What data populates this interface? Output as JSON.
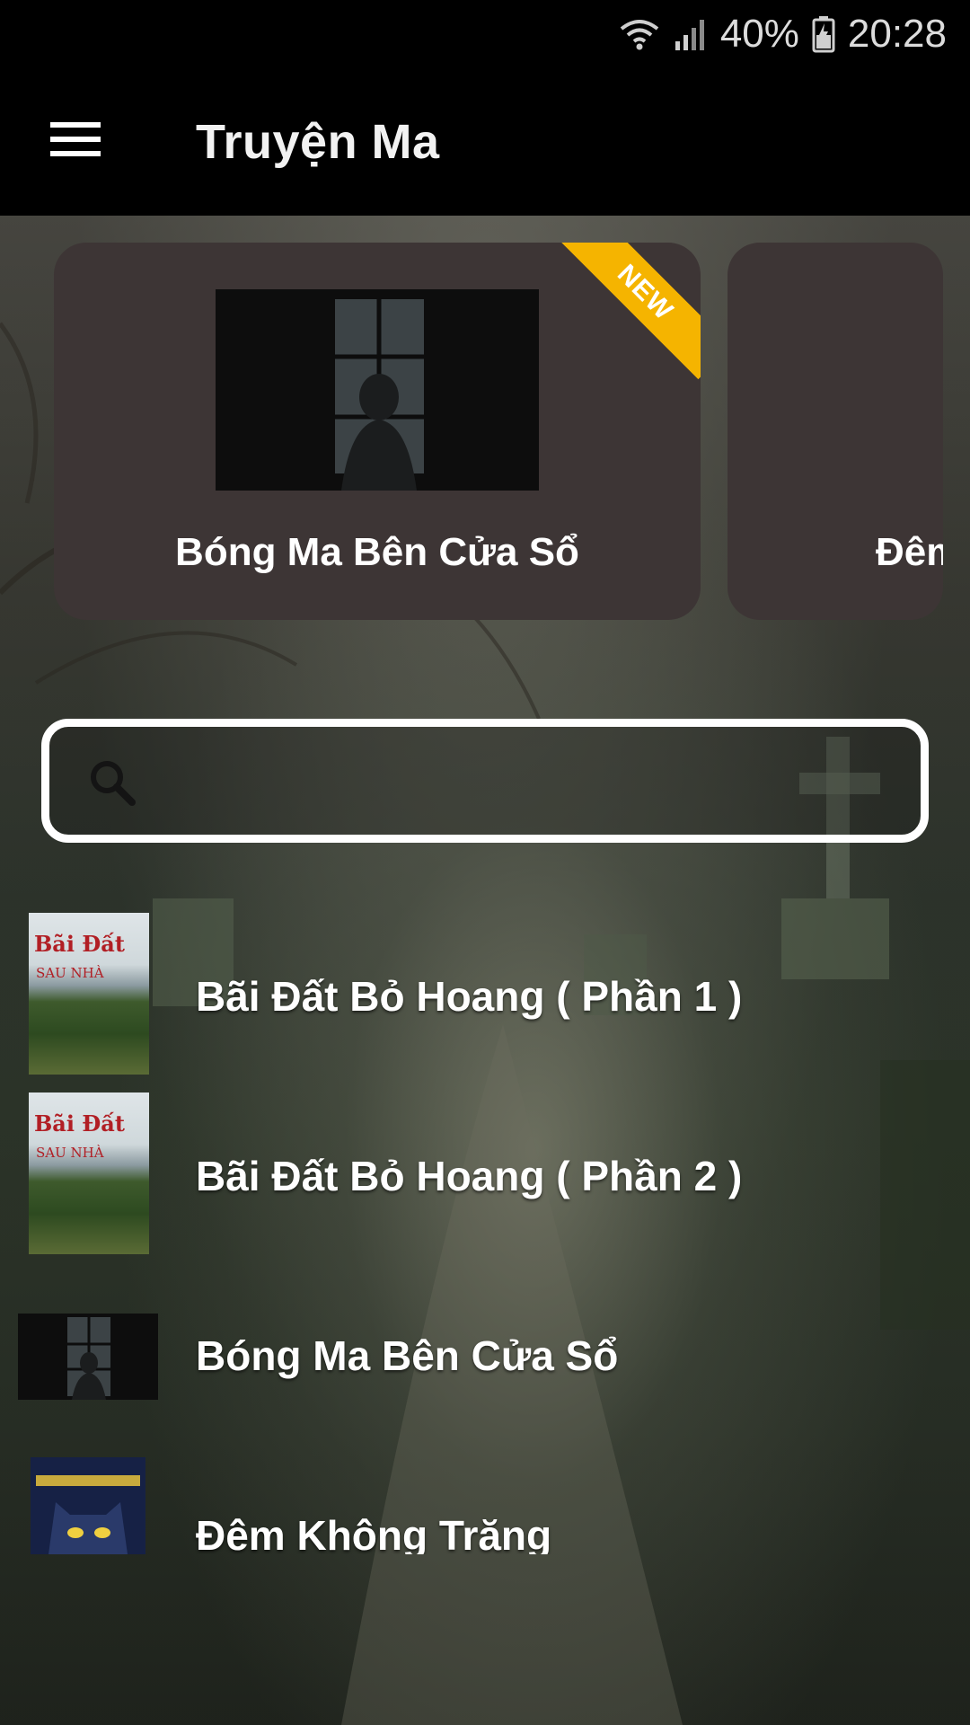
{
  "status_bar": {
    "battery": "40%",
    "time": "20:28"
  },
  "app_bar": {
    "title": "Truyện Ma"
  },
  "carousel": {
    "cards": [
      {
        "title": "Bóng Ma Bên Cửa Sổ",
        "badge": "NEW"
      },
      {
        "title": "Đêm"
      }
    ]
  },
  "search": {
    "placeholder": "",
    "value": ""
  },
  "stories": [
    {
      "title": "Bãi Đất Bỏ Hoang ( Phần 1 )"
    },
    {
      "title": "Bãi Đất Bỏ Hoang ( Phần 2 )"
    },
    {
      "title": "Bóng Ma Bên Cửa Sổ"
    },
    {
      "title": "Đêm Không Trăng"
    }
  ],
  "book_cover": {
    "line1": "Bãi Đất",
    "line2": "SAU NHÀ"
  },
  "colors": {
    "card": "#3d3535",
    "ribbon": "#f5b400",
    "bar": "#000000"
  }
}
